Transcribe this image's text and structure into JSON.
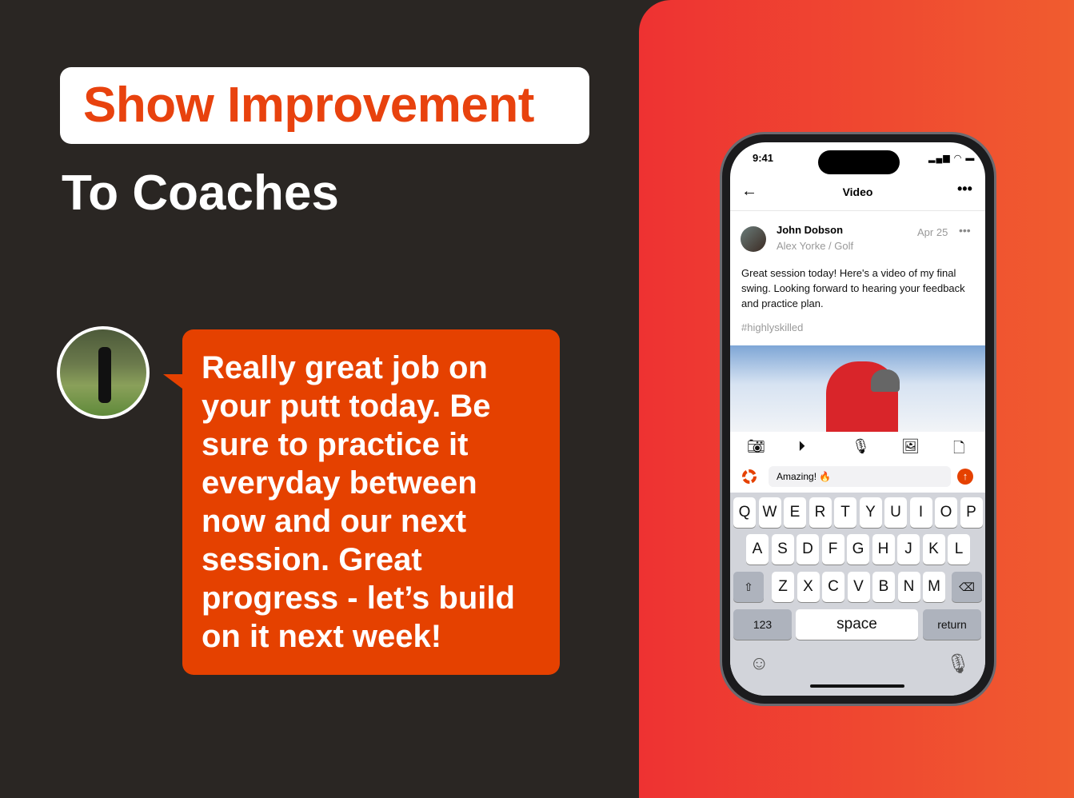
{
  "headline": {
    "highlight": "Show Improvement",
    "subtitle": "To Coaches"
  },
  "coach_message": "Really great job on your putt today. Be sure to practice it everyday between now and our next session. Great progress - let’s build on it next week!",
  "phone": {
    "status_time": "9:41",
    "nav": {
      "title": "Video",
      "back_icon": "arrow-left-icon",
      "more_icon": "more-icon"
    },
    "post": {
      "author": "John Dobson",
      "meta": "Alex Yorke /  Golf",
      "date": "Apr 25",
      "body": "Great session today! Here's a video of my final swing. Looking forward to hearing your feedback and practice plan.",
      "hashtag": "#highlyskilled"
    },
    "attach_icons": [
      "camera-icon",
      "play-icon",
      "microphone-icon",
      "image-icon",
      "file-icon"
    ],
    "comment_value": "Amazing! 🔥",
    "keyboard": {
      "row1": [
        "Q",
        "W",
        "E",
        "R",
        "T",
        "Y",
        "U",
        "I",
        "O",
        "P"
      ],
      "row2": [
        "A",
        "S",
        "D",
        "F",
        "G",
        "H",
        "J",
        "K",
        "L"
      ],
      "row3": [
        "Z",
        "X",
        "C",
        "V",
        "B",
        "N",
        "M"
      ],
      "numbers": "123",
      "space": "space",
      "return": "return"
    }
  },
  "colors": {
    "accent": "#e54100",
    "background": "#2a2623",
    "gradient_start": "#ee3232",
    "gradient_end": "#f05c2f"
  }
}
